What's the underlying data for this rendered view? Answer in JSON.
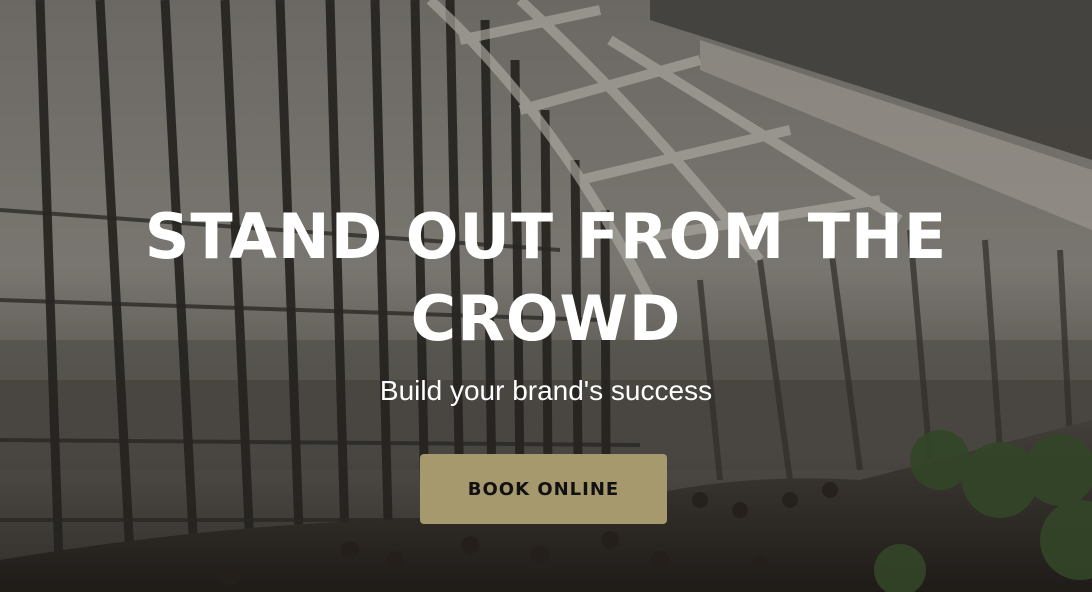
{
  "hero": {
    "headline": "STAND OUT FROM THE CROWD",
    "subtitle": "Build your brand's success",
    "cta_label": "BOOK ONLINE"
  },
  "colors": {
    "cta_background": "#a7996e",
    "headline_text": "#ffffff",
    "cta_text": "#111111"
  }
}
